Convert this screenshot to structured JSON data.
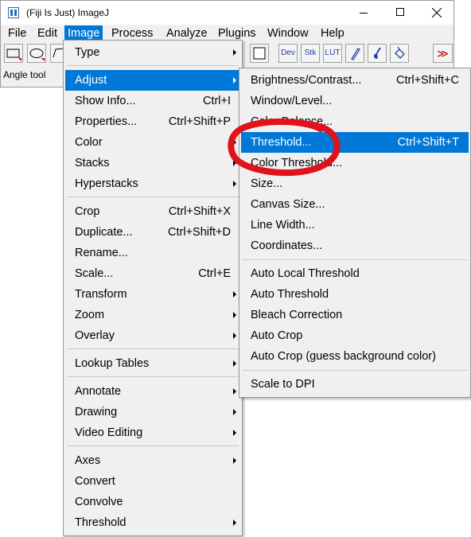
{
  "window": {
    "title": "(Fiji Is Just) ImageJ",
    "status_text": "Angle tool"
  },
  "menubar": {
    "items": [
      "File",
      "Edit",
      "Image",
      "Process",
      "Analyze",
      "Plugins",
      "Window",
      "Help"
    ],
    "active": "Image"
  },
  "toolbar": {
    "dev_label": "Dev",
    "stk_label": "Stk",
    "lut_label": "LUT",
    "more_label": "≫"
  },
  "image_menu": {
    "items": [
      {
        "label": "Type",
        "shortcut": "",
        "submenu": true
      },
      {
        "label": "Adjust",
        "shortcut": "",
        "submenu": true,
        "highlighted": true
      },
      {
        "label": "Show Info...",
        "shortcut": "Ctrl+I"
      },
      {
        "label": "Properties...",
        "shortcut": "Ctrl+Shift+P"
      },
      {
        "label": "Color",
        "shortcut": "",
        "submenu": true
      },
      {
        "label": "Stacks",
        "shortcut": "",
        "submenu": true
      },
      {
        "label": "Hyperstacks",
        "shortcut": "",
        "submenu": true
      },
      {
        "label": "Crop",
        "shortcut": "Ctrl+Shift+X"
      },
      {
        "label": "Duplicate...",
        "shortcut": "Ctrl+Shift+D"
      },
      {
        "label": "Rename...",
        "shortcut": ""
      },
      {
        "label": "Scale...",
        "shortcut": "Ctrl+E"
      },
      {
        "label": "Transform",
        "shortcut": "",
        "submenu": true
      },
      {
        "label": "Zoom",
        "shortcut": "",
        "submenu": true
      },
      {
        "label": "Overlay",
        "shortcut": "",
        "submenu": true
      },
      {
        "label": "Lookup Tables",
        "shortcut": "",
        "submenu": true
      },
      {
        "label": "Annotate",
        "shortcut": "",
        "submenu": true
      },
      {
        "label": "Drawing",
        "shortcut": "",
        "submenu": true
      },
      {
        "label": "Video Editing",
        "shortcut": "",
        "submenu": true
      },
      {
        "label": "Axes",
        "shortcut": "",
        "submenu": true
      },
      {
        "label": "Convert",
        "shortcut": ""
      },
      {
        "label": "Convolve",
        "shortcut": ""
      },
      {
        "label": "Threshold",
        "shortcut": "",
        "submenu": true
      }
    ]
  },
  "adjust_menu": {
    "items": [
      {
        "label": "Brightness/Contrast...",
        "shortcut": "Ctrl+Shift+C"
      },
      {
        "label": "Window/Level...",
        "shortcut": ""
      },
      {
        "label": "Color Balance...",
        "shortcut": ""
      },
      {
        "label": "Threshold...",
        "shortcut": "Ctrl+Shift+T",
        "highlighted": true
      },
      {
        "label": "Color Threshold...",
        "shortcut": ""
      },
      {
        "label": "Size...",
        "shortcut": ""
      },
      {
        "label": "Canvas Size...",
        "shortcut": ""
      },
      {
        "label": "Line Width...",
        "shortcut": ""
      },
      {
        "label": "Coordinates...",
        "shortcut": ""
      },
      {
        "label": "Auto Local Threshold",
        "shortcut": ""
      },
      {
        "label": "Auto Threshold",
        "shortcut": ""
      },
      {
        "label": "Bleach Correction",
        "shortcut": ""
      },
      {
        "label": "Auto Crop",
        "shortcut": ""
      },
      {
        "label": "Auto Crop (guess background color)",
        "shortcut": ""
      },
      {
        "label": "Scale to DPI",
        "shortcut": ""
      }
    ]
  },
  "colors": {
    "highlight": "#0078d7",
    "annotation": "#e0121b"
  }
}
